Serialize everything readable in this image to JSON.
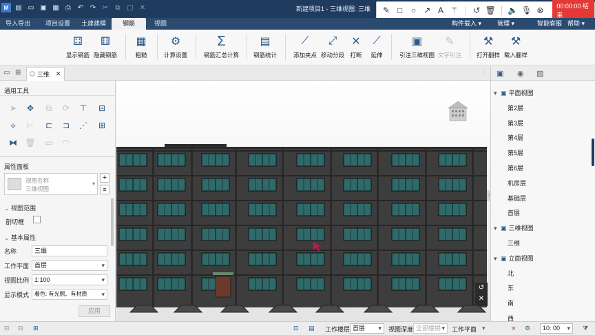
{
  "titlebar": {
    "title": "新建项目1 - 三维视图: 三维",
    "quick_access_icons": [
      "app-logo-icon",
      "new-file-icon",
      "open-folder-icon",
      "save-icon",
      "save-as-icon",
      "print-icon",
      "undo-icon",
      "redo-icon",
      "cut-icon",
      "copy-icon",
      "paste-icon",
      "delete-icon"
    ]
  },
  "recorder": {
    "time": "00:00:00 结束",
    "tools": [
      "pen-icon",
      "rectangle-icon",
      "circle-icon",
      "arrow-icon",
      "text-icon",
      "magic-wand-icon",
      "undo-icon",
      "trash-icon",
      "speaker-icon",
      "microphone-icon",
      "close-icon"
    ]
  },
  "menubar": {
    "tabs": [
      "导入导出",
      "项目设置",
      "土建建模",
      "钢筋",
      "视图"
    ],
    "active_tab": "钢筋",
    "right_items": [
      "构件载入 ▾",
      "管理 ▾",
      "智能客服",
      "帮助 ▾"
    ]
  },
  "ribbon": {
    "buttons": [
      {
        "label": "显示钢筋",
        "icon": "show-rebar-icon",
        "enabled": true
      },
      {
        "label": "隐藏钢筋",
        "icon": "hide-rebar-icon",
        "enabled": true
      },
      {
        "label": "粗糙",
        "icon": "coarse-icon",
        "enabled": true
      },
      {
        "label": "计算设置",
        "icon": "calc-settings-icon",
        "enabled": true
      },
      {
        "label": "钢筋汇总计算",
        "icon": "sum-icon",
        "enabled": true
      },
      {
        "label": "钢筋统计",
        "icon": "statistics-icon",
        "enabled": true
      },
      {
        "label": "添加夹点",
        "icon": "add-grip-icon",
        "enabled": true
      },
      {
        "label": "移动分段",
        "icon": "move-segment-icon",
        "enabled": true
      },
      {
        "label": "打断",
        "icon": "break-icon",
        "enabled": true
      },
      {
        "label": "延伸",
        "icon": "extend-icon",
        "enabled": true
      },
      {
        "label": "引注三维视图",
        "icon": "annotate-3d-icon",
        "enabled": true
      },
      {
        "label": "文字引注",
        "icon": "text-annotate-icon",
        "enabled": false
      },
      {
        "label": "打开翻样",
        "icon": "open-layout-icon",
        "enabled": true
      },
      {
        "label": "载入翻样",
        "icon": "load-layout-icon",
        "enabled": true
      }
    ]
  },
  "doctabs": {
    "active_tab": "三维"
  },
  "leftpanel": {
    "tools_title": "通用工具",
    "properties_title": "属性面板",
    "view_name_placeholder_1": "视图名称",
    "view_name_placeholder_2": "三维视图",
    "section_view_range": "视图范围",
    "crop_box_label": "剖切框",
    "section_basic": "基本属性",
    "props": [
      {
        "label": "名称",
        "value": "三维",
        "select": false
      },
      {
        "label": "工作平面",
        "value": "首层",
        "select": true
      },
      {
        "label": "视图比例",
        "value": "1:100",
        "select": true
      },
      {
        "label": "显示模式",
        "value": "着色: 有光照、有材质",
        "select": true
      }
    ],
    "apply_label": "应用"
  },
  "rightpanel": {
    "tree": [
      {
        "label": "平面视图",
        "level": 0,
        "expanded": true
      },
      {
        "label": "第2层",
        "level": 1
      },
      {
        "label": "第3层",
        "level": 1
      },
      {
        "label": "第4层",
        "level": 1
      },
      {
        "label": "第5层",
        "level": 1
      },
      {
        "label": "第6层",
        "level": 1
      },
      {
        "label": "机房层",
        "level": 1
      },
      {
        "label": "基础层",
        "level": 1
      },
      {
        "label": "首层",
        "level": 1
      },
      {
        "label": "三维视图",
        "level": 0,
        "expanded": true
      },
      {
        "label": "三维",
        "level": 1
      },
      {
        "label": "立面视图",
        "level": 0,
        "expanded": true
      },
      {
        "label": "北",
        "level": 1
      },
      {
        "label": "东",
        "level": 1
      },
      {
        "label": "南",
        "level": 1
      },
      {
        "label": "西",
        "level": 1
      }
    ]
  },
  "statusbar": {
    "work_floor_label": "工作楼层",
    "work_floor_value": "首层",
    "view_depth_label": "视图深度",
    "view_depth_value": "全部楼层",
    "work_plane_label": "工作平面",
    "time_value": "10: 00"
  },
  "colors": {
    "titlebar": "#1f3b5e",
    "menubar": "#2b4a70",
    "building": "#3a3a3a",
    "window_glass": "#2f6a6a",
    "recorder_red": "#e53935"
  }
}
